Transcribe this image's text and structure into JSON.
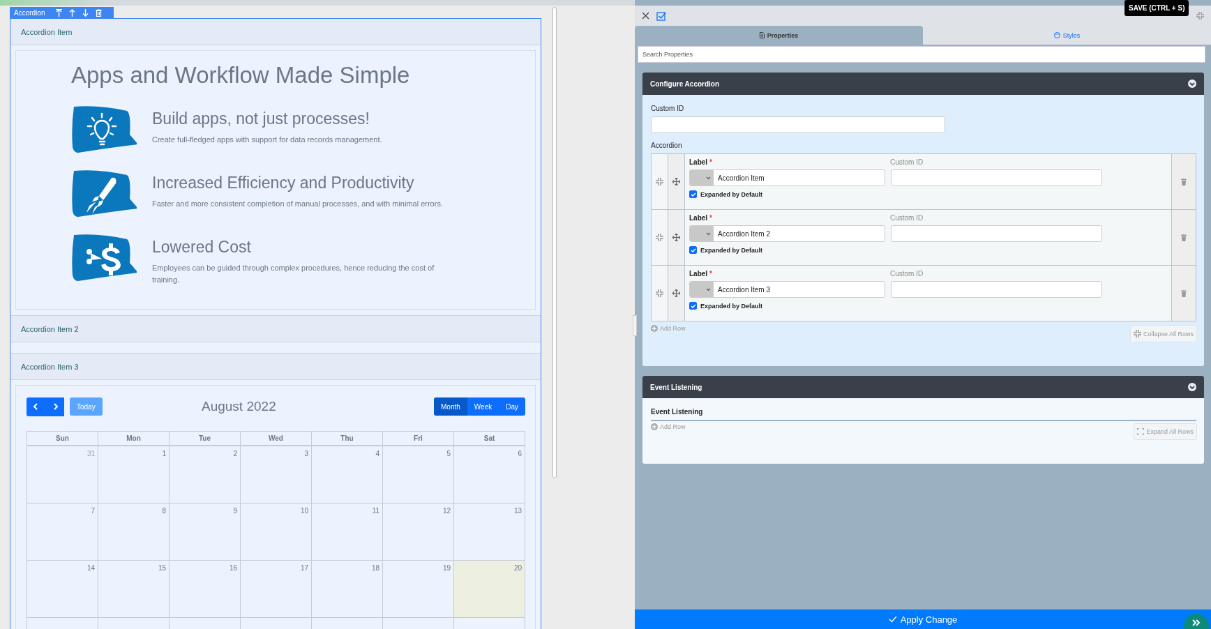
{
  "editor_tag": {
    "label": "Accordion"
  },
  "accordion": [
    {
      "label": "Accordion Item",
      "expanded": true,
      "content": {
        "kind": "features",
        "title": "Apps and Workflow Made Simple",
        "items": [
          {
            "kind": "bulb",
            "title": "Build apps, not just processes!",
            "text": "Create full-fledged apps with support for data records management."
          },
          {
            "kind": "rocket",
            "title": "Increased Efficiency and Productivity",
            "text": "Faster and more consistent completion of manual processes, and with minimal errors."
          },
          {
            "kind": "money",
            "title": "Lowered Cost",
            "text": "Employees can be guided through complex procedures, hence reducing the cost of training."
          }
        ]
      }
    },
    {
      "label": "Accordion Item 2",
      "expanded": false
    },
    {
      "label": "Accordion Item 3",
      "expanded": true,
      "content": {
        "kind": "calendar",
        "today_button": "Today",
        "title": "August 2022",
        "views": [
          {
            "label": "Month",
            "selected": true
          },
          {
            "label": "Week",
            "selected": false
          },
          {
            "label": "Day",
            "selected": false
          }
        ],
        "weekdays": [
          "Sun",
          "Mon",
          "Tue",
          "Wed",
          "Thu",
          "Fri",
          "Sat"
        ],
        "weeks": [
          [
            {
              "day": "31",
              "other_month": true,
              "today": false
            },
            {
              "day": "1",
              "other_month": false,
              "today": false
            },
            {
              "day": "2",
              "other_month": false,
              "today": false
            },
            {
              "day": "3",
              "other_month": false,
              "today": false
            },
            {
              "day": "4",
              "other_month": false,
              "today": false
            },
            {
              "day": "5",
              "other_month": false,
              "today": false
            },
            {
              "day": "6",
              "other_month": false,
              "today": false
            }
          ],
          [
            {
              "day": "7",
              "other_month": false,
              "today": false
            },
            {
              "day": "8",
              "other_month": false,
              "today": false
            },
            {
              "day": "9",
              "other_month": false,
              "today": false
            },
            {
              "day": "10",
              "other_month": false,
              "today": false
            },
            {
              "day": "11",
              "other_month": false,
              "today": false
            },
            {
              "day": "12",
              "other_month": false,
              "today": false
            },
            {
              "day": "13",
              "other_month": false,
              "today": false
            }
          ],
          [
            {
              "day": "14",
              "other_month": false,
              "today": false
            },
            {
              "day": "15",
              "other_month": false,
              "today": false
            },
            {
              "day": "16",
              "other_month": false,
              "today": false
            },
            {
              "day": "17",
              "other_month": false,
              "today": false
            },
            {
              "day": "18",
              "other_month": false,
              "today": false
            },
            {
              "day": "19",
              "other_month": false,
              "today": false
            },
            {
              "day": "20",
              "other_month": false,
              "today": true
            }
          ]
        ]
      }
    }
  ],
  "properties_panel": {
    "save_tooltip": "SAVE (CTRL + S)",
    "tabs": [
      {
        "label": "Properties",
        "selected": true
      },
      {
        "label": "Styles",
        "selected": false
      }
    ],
    "search": {
      "placeholder": "Search Properties"
    },
    "configure_section": {
      "title": "Configure Accordion",
      "custom_id_label": "Custom ID",
      "grid_label": "Accordion",
      "rows": [
        {
          "label_caption": "Label",
          "required_mark": "*",
          "value": "Accordion Item",
          "custom_id_caption": "Custom ID",
          "expanded_caption": "Expanded by Default",
          "expanded": true
        },
        {
          "label_caption": "Label",
          "required_mark": "*",
          "value": "Accordion Item 2",
          "custom_id_caption": "Custom ID",
          "expanded_caption": "Expanded by Default",
          "expanded": true
        },
        {
          "label_caption": "Label",
          "required_mark": "*",
          "value": "Accordion Item 3",
          "custom_id_caption": "Custom ID",
          "expanded_caption": "Expanded by Default",
          "expanded": true
        }
      ],
      "add_row": "Add Row",
      "collapse_all": "Collapse All Rows"
    },
    "event_section": {
      "title": "Event Listening",
      "field_label": "Event Listening",
      "add_row": "Add Row",
      "expand_all": "Expand All Rows"
    },
    "apply_button": "Apply Change"
  }
}
